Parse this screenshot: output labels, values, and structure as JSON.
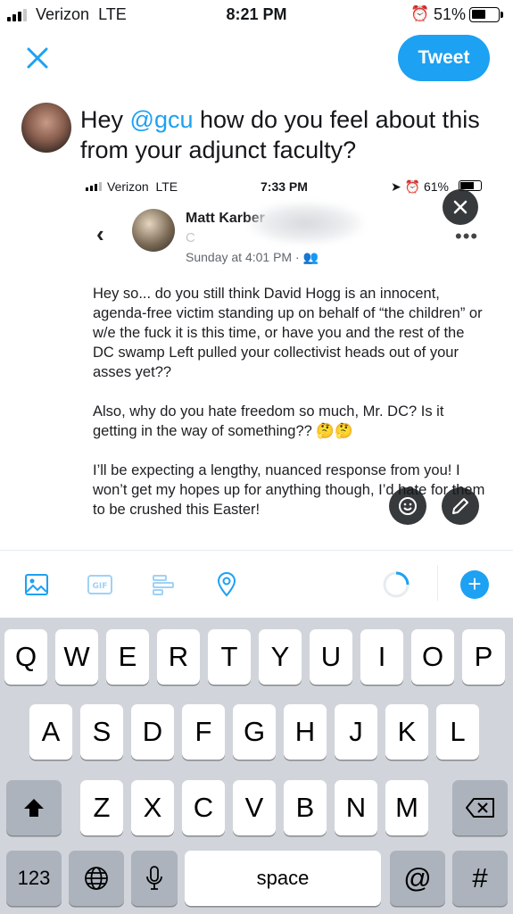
{
  "status_bar": {
    "carrier": "Verizon",
    "network": "LTE",
    "time": "8:21 PM",
    "battery": "51%",
    "alarm_icon": "alarm-icon"
  },
  "compose": {
    "close_icon": "close-icon",
    "tweet_label": "Tweet",
    "text_prefix": "Hey ",
    "mention": "@gcu",
    "text_suffix": " how do you feel about this from your adjunct faculty?"
  },
  "attachment": {
    "status": {
      "carrier": "Verizon",
      "network": "LTE",
      "time": "7:33 PM",
      "battery": "61%"
    },
    "post": {
      "author": "Matt Karber",
      "subtitle": "C",
      "date": "Sunday at 4:01 PM ·",
      "paragraphs": [
        "Hey so... do you still think David Hogg is an innocent, agenda-free victim standing up on behalf of “the children” or w/e the fuck it is this time, or have you and the rest of the DC swamp Left pulled your collectivist heads out of your asses yet??",
        "Also, why do you hate freedom so much, Mr. DC? Is it getting in the way of something?? 🤔🤔",
        "I’ll be expecting a lengthy, nuanced response from you! I won’t get my hopes up for anything though, I’d hate for them to be crushed this Easter!"
      ]
    }
  },
  "toolbar": {
    "icons": [
      "image-icon",
      "gif-icon",
      "poll-icon",
      "location-icon",
      "progress-ring-icon",
      "add-thread-icon"
    ],
    "gif_label": "GIF",
    "plus_label": "+"
  },
  "keyboard": {
    "row1": [
      "Q",
      "W",
      "E",
      "R",
      "T",
      "Y",
      "U",
      "I",
      "O",
      "P"
    ],
    "row2": [
      "A",
      "S",
      "D",
      "F",
      "G",
      "H",
      "J",
      "K",
      "L"
    ],
    "row3": [
      "Z",
      "X",
      "C",
      "V",
      "B",
      "N",
      "M"
    ],
    "numbers_label": "123",
    "space_label": "space",
    "at_label": "@",
    "hash_label": "#"
  }
}
